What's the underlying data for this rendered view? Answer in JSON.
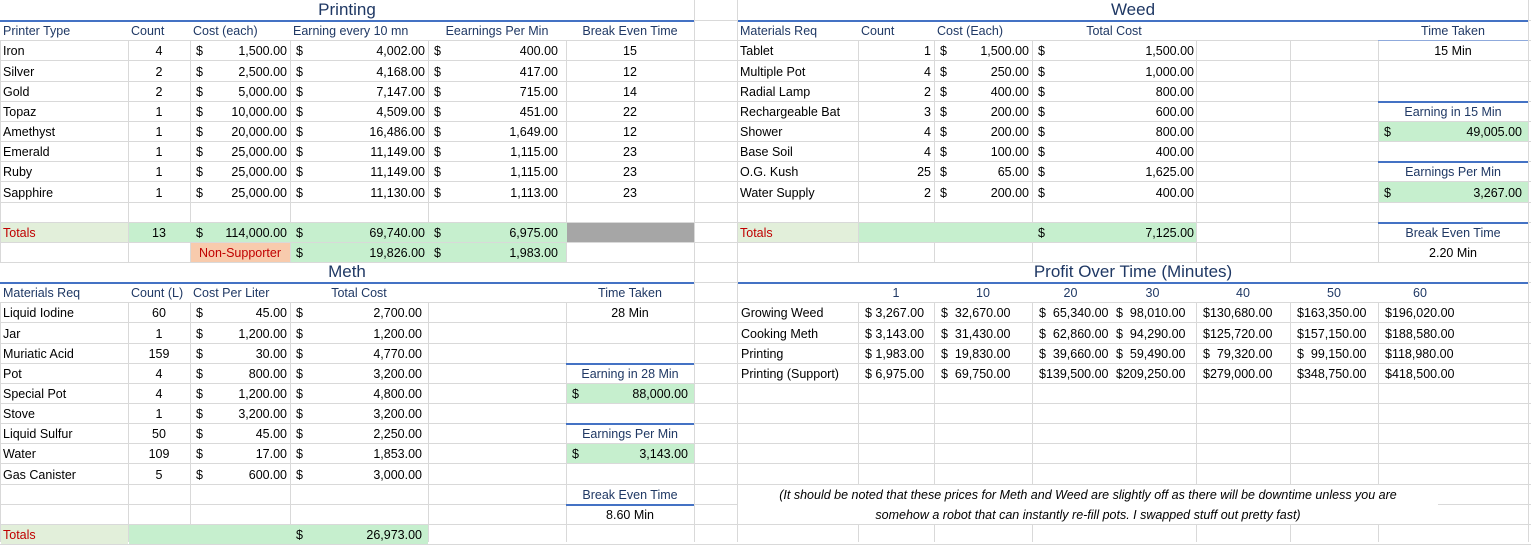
{
  "printing": {
    "title": "Printing",
    "headers": [
      "Printer Type",
      "Count",
      "Cost (each)",
      "Earning every 10 mn",
      "Eearnings Per Min",
      "Break Even Time"
    ],
    "rows": [
      [
        "Iron",
        "4",
        "1,500.00",
        "4,002.00",
        "400.00",
        "15"
      ],
      [
        "Silver",
        "2",
        "2,500.00",
        "4,168.00",
        "417.00",
        "12"
      ],
      [
        "Gold",
        "2",
        "5,000.00",
        "7,147.00",
        "715.00",
        "14"
      ],
      [
        "Topaz",
        "1",
        "10,000.00",
        "4,509.00",
        "451.00",
        "22"
      ],
      [
        "Amethyst",
        "1",
        "20,000.00",
        "16,486.00",
        "1,649.00",
        "12"
      ],
      [
        "Emerald",
        "1",
        "25,000.00",
        "11,149.00",
        "1,115.00",
        "23"
      ],
      [
        "Ruby",
        "1",
        "25,000.00",
        "11,149.00",
        "1,115.00",
        "23"
      ],
      [
        "Sapphire",
        "1",
        "25,000.00",
        "11,130.00",
        "1,113.00",
        "23"
      ]
    ],
    "totals": {
      "label": "Totals",
      "count": "13",
      "cost": "114,000.00",
      "earn10": "69,740.00",
      "epm": "6,975.00"
    },
    "non_supporter": {
      "label": "Non-Supporter",
      "earn10": "19,826.00",
      "epm": "1,983.00"
    }
  },
  "weed": {
    "title": "Weed",
    "headers": [
      "Materials Req",
      "Count",
      "Cost (Each)",
      "Total Cost"
    ],
    "rows": [
      [
        "Tablet",
        "1",
        "1,500.00",
        "1,500.00"
      ],
      [
        "Multiple Pot",
        "4",
        "250.00",
        "1,000.00"
      ],
      [
        "Radial Lamp",
        "2",
        "400.00",
        "800.00"
      ],
      [
        "Rechargeable Bat",
        "3",
        "200.00",
        "600.00"
      ],
      [
        "Shower",
        "4",
        "200.00",
        "800.00"
      ],
      [
        "Base Soil",
        "4",
        "100.00",
        "400.00"
      ],
      [
        "O.G. Kush",
        "25",
        "65.00",
        "1,625.00"
      ],
      [
        "Water Supply",
        "2",
        "200.00",
        "400.00"
      ]
    ],
    "totals": {
      "label": "Totals",
      "total": "7,125.00"
    },
    "side": {
      "time_taken_label": "Time Taken",
      "time_taken": "15 Min",
      "earning_label": "Earning in 15 Min",
      "earning": "49,005.00",
      "epm_label": "Earnings Per Min",
      "epm": "3,267.00",
      "break_label": "Break Even Time",
      "break_even": "2.20 Min"
    }
  },
  "meth": {
    "title": "Meth",
    "headers": [
      "Materials Req",
      "Count (L)",
      "Cost Per Liter",
      "Total Cost"
    ],
    "rows": [
      [
        "Liquid Iodine",
        "60",
        "45.00",
        "2,700.00"
      ],
      [
        "Jar",
        "1",
        "1,200.00",
        "1,200.00"
      ],
      [
        "Muriatic Acid",
        "159",
        "30.00",
        "4,770.00"
      ],
      [
        "Pot",
        "4",
        "800.00",
        "3,200.00"
      ],
      [
        "Special Pot",
        "4",
        "1,200.00",
        "4,800.00"
      ],
      [
        "Stove",
        "1",
        "3,200.00",
        "3,200.00"
      ],
      [
        "Liquid Sulfur",
        "50",
        "45.00",
        "2,250.00"
      ],
      [
        "Water",
        "109",
        "17.00",
        "1,853.00"
      ],
      [
        "Gas Canister",
        "5",
        "600.00",
        "3,000.00"
      ]
    ],
    "totals": {
      "label": "Totals",
      "total": "26,973.00"
    },
    "side": {
      "time_taken_label": "Time Taken",
      "time_taken": "28 Min",
      "earning_label": "Earning in 28 Min",
      "earning": "88,000.00",
      "epm_label": "Earnings Per Min",
      "epm": "3,143.00",
      "break_label": "Break Even Time",
      "break_even": "8.60 Min"
    }
  },
  "profit": {
    "title": "Profit Over Time (Minutes)",
    "columns": [
      "1",
      "10",
      "20",
      "30",
      "40",
      "50",
      "60"
    ],
    "rows": [
      {
        "label": "Growing Weed",
        "values": [
          "$ 3,267.00",
          "$  32,670.00",
          "$  65,340.00",
          "$  98,010.00",
          "$130,680.00",
          "$163,350.00",
          "$196,020.00"
        ]
      },
      {
        "label": "Cooking Meth",
        "values": [
          "$ 3,143.00",
          "$  31,430.00",
          "$  62,860.00",
          "$  94,290.00",
          "$125,720.00",
          "$157,150.00",
          "$188,580.00"
        ]
      },
      {
        "label": "Printing",
        "values": [
          "$ 1,983.00",
          "$  19,830.00",
          "$  39,660.00",
          "$  59,490.00",
          "$  79,320.00",
          "$  99,150.00",
          "$118,980.00"
        ]
      },
      {
        "label": "Printing (Support)",
        "values": [
          "$ 6,975.00",
          "$  69,750.00",
          "$139,500.00",
          "$209,250.00",
          "$279,000.00",
          "$348,750.00",
          "$418,500.00"
        ]
      }
    ]
  },
  "note": {
    "line1": "(It should be noted that these prices for Meth and Weed are slightly off as there will be downtime unless you are",
    "line2": "somehow a robot that can instantly re-fill pots. I swapped stuff out pretty fast)"
  },
  "symbols": {
    "dollar": "$"
  },
  "colors": {
    "header_text": "#1f3864",
    "totals_text": "#c00000",
    "green_fill": "#c6efce",
    "gray_fill": "#a6a6a6",
    "orange_fill": "#f8cbad",
    "header_rule": "#4472c4"
  }
}
